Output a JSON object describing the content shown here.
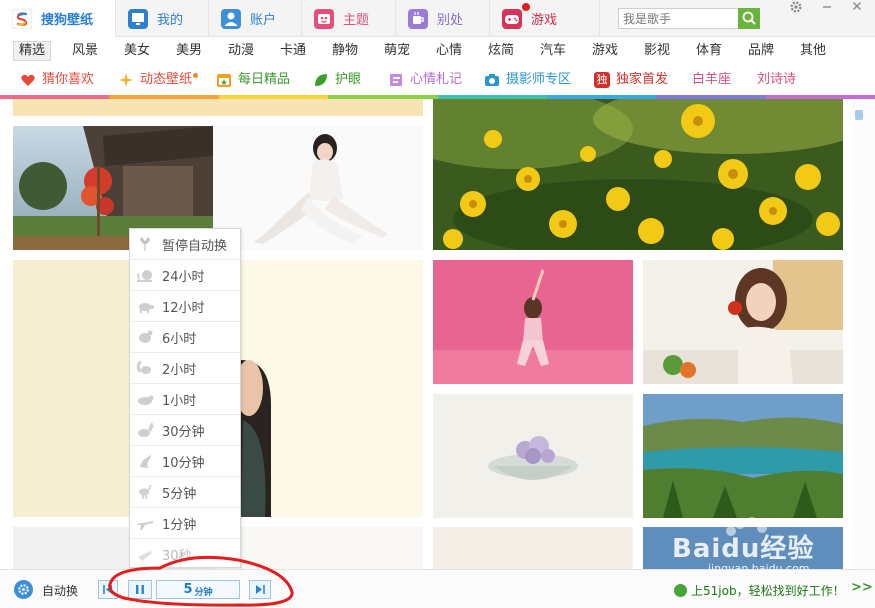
{
  "app": {
    "brand": "搜狗壁纸",
    "tabs": [
      {
        "label": "我的",
        "color": "#2d7fcf"
      },
      {
        "label": "账户",
        "color": "#2d7fcf"
      },
      {
        "label": "主题",
        "color": "#e0507a"
      },
      {
        "label": "别处",
        "color": "#8a6dcf"
      },
      {
        "label": "游戏",
        "color": "#cc2b4a"
      }
    ]
  },
  "search": {
    "placeholder": "我是歌手"
  },
  "categories": [
    "精选",
    "风景",
    "美女",
    "美男",
    "动漫",
    "卡通",
    "静物",
    "萌宠",
    "心情",
    "炫简",
    "汽车",
    "游戏",
    "影视",
    "体育",
    "品牌",
    "其他"
  ],
  "active_category": "精选",
  "features": [
    {
      "label": "猜你喜欢",
      "color": "#e8483a"
    },
    {
      "label": "动态壁纸",
      "color": "#e8483a"
    },
    {
      "label": "每日精品",
      "color": "#3a9a2b"
    },
    {
      "label": "护眼",
      "color": "#3a9a2b"
    },
    {
      "label": "心情札记",
      "color": "#b26fd6"
    },
    {
      "label": "摄影师专区",
      "color": "#2d95d6"
    },
    {
      "label": "独家首发",
      "color": "#d4302a"
    },
    {
      "label": "白羊座",
      "color": "#d94f7a"
    },
    {
      "label": "刘诗诗",
      "color": "#d94f7a"
    }
  ],
  "colorbar": [
    "#f06b8a",
    "#f7a43c",
    "#f5d53a",
    "#8cd14a",
    "#3fc1b0",
    "#3aa7e6",
    "#7f77e2",
    "#c76bd6"
  ],
  "interval_menu": {
    "items": [
      "暂停自动换",
      "24小时",
      "12小时",
      "6小时",
      "2小时",
      "1小时",
      "30分钟",
      "10分钟",
      "5分钟",
      "1分钟",
      "30秒"
    ]
  },
  "bottom": {
    "auto_switch_label": "自动换",
    "interval_value": "5",
    "interval_unit": "分钟",
    "ad_text": "上51job，轻松找到好工作！",
    "more": ">>"
  },
  "watermark": {
    "text": "Baidu经验",
    "sub": "jingyan.baidu.com"
  }
}
